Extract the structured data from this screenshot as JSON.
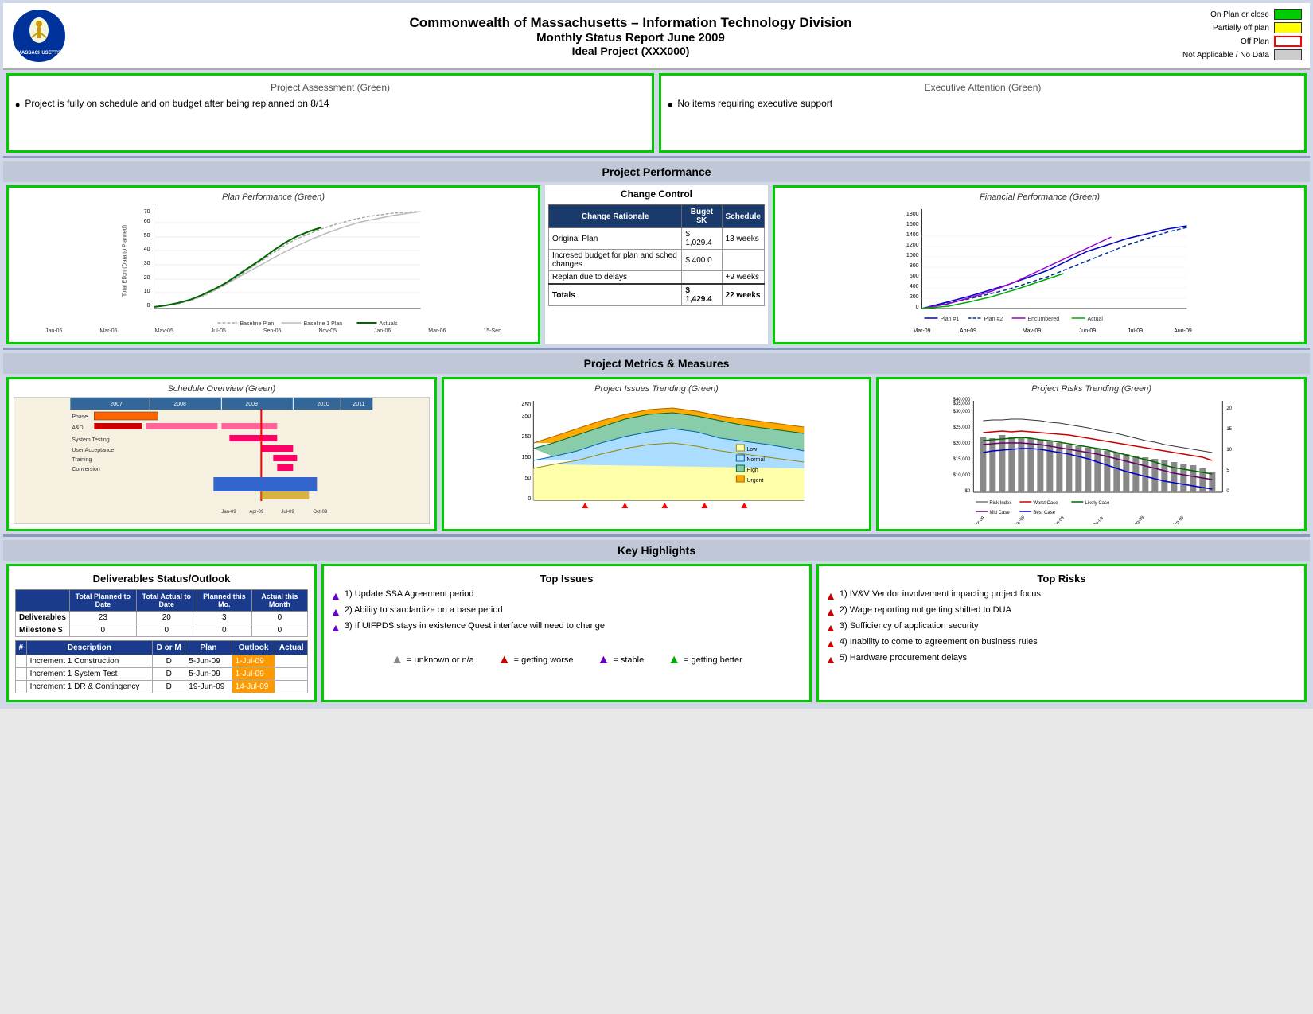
{
  "header": {
    "title_line1": "Commonwealth of Massachusetts – Information Technology Division",
    "title_line2": "Monthly Status Report June 2009",
    "title_line3": "Ideal Project (XXX000)"
  },
  "legend": {
    "items": [
      {
        "label": "On Plan or close",
        "color": "green"
      },
      {
        "label": "Partially off plan",
        "color": "yellow"
      },
      {
        "label": "Off Plan",
        "color": "red"
      },
      {
        "label": "Not Applicable / No Data",
        "color": "gray"
      }
    ]
  },
  "project_assessment": {
    "title": "Project Assessment (Green)",
    "text": "Project is fully on schedule and on budget after being replanned on 8/14"
  },
  "executive_attention": {
    "title": "Executive Attention (Green)",
    "text": "No items requiring executive support"
  },
  "project_performance_header": "Project Performance",
  "plan_performance": {
    "title": "Plan Performance (Green)"
  },
  "change_control": {
    "title": "Change Control",
    "headers": [
      "Change Rationale",
      "Buget $K",
      "Schedule"
    ],
    "rows": [
      {
        "rationale": "Original Plan",
        "budget": "$ 1,029.4",
        "schedule": "13 weeks"
      },
      {
        "rationale": "Incresed budget for plan and sched changes",
        "budget": "$ 400.0",
        "schedule": ""
      },
      {
        "rationale": "Replan due to delays",
        "budget": "",
        "schedule": "+9 weeks"
      },
      {
        "rationale": "Totals",
        "budget": "$ 1,429.4",
        "schedule": "22 weeks"
      }
    ]
  },
  "financial_performance": {
    "title": "Financial Performance (Green)",
    "legend": [
      "Plan #1",
      "Plan #2",
      "Encumbered",
      "Actual"
    ]
  },
  "project_metrics_header": "Project Metrics & Measures",
  "schedule_overview": {
    "title": "Schedule Overview (Green)"
  },
  "issues_trending": {
    "title": "Project Issues Trending (Green)",
    "legend": [
      "Low",
      "Normal",
      "High",
      "Urgent"
    ]
  },
  "risks_trending": {
    "title": "Project Risks Trending (Green)",
    "legend": [
      "Risk Index",
      "Worst Case",
      "Likely Case",
      "Mid Case",
      "Best Case"
    ]
  },
  "key_highlights_header": "Key Highlights",
  "top_issues": {
    "title": "Top Issues",
    "items": [
      "Update SSA Agreement period",
      "Ability to standardize on a base period",
      "If UIFPDS stays in existence Quest interface will need to change"
    ]
  },
  "deliverables": {
    "title": "Deliverables Status/Outlook",
    "summary_headers": [
      "",
      "Total Planned to Date",
      "Total Actual to Date",
      "Planned this Mo.",
      "Actual this Month"
    ],
    "summary_rows": [
      {
        "label": "Deliverables",
        "planned": "23",
        "actual": "20",
        "planned_mo": "3",
        "actual_mo": "0"
      },
      {
        "label": "Milestone $",
        "planned": "0",
        "actual": "0",
        "planned_mo": "0",
        "actual_mo": "0"
      }
    ],
    "detail_headers": [
      "#",
      "Description",
      "D or M",
      "Plan",
      "Outlook",
      "Actual"
    ],
    "detail_rows": [
      {
        "num": "",
        "desc": "Increment 1 Construction",
        "dom": "D",
        "plan": "5-Jun-09",
        "outlook": "1-Jul-09",
        "actual": ""
      },
      {
        "num": "",
        "desc": "Increment 1 System Test",
        "dom": "D",
        "plan": "5-Jun-09",
        "outlook": "1-Jul-09",
        "actual": ""
      },
      {
        "num": "",
        "desc": "Increment 1 DR & Contingency",
        "dom": "D",
        "plan": "19-Jun-09",
        "outlook": "14-Jul-09",
        "actual": ""
      }
    ]
  },
  "top_risks": {
    "title": "Top Risks",
    "items": [
      "IV&V Vendor involvement impacting project focus",
      "Wage reporting not getting shifted to DUA",
      "Sufficiency of application security",
      "Inability to come to agreement on business rules",
      "Hardware procurement delays"
    ]
  },
  "bottom_legend": {
    "items": [
      {
        "symbol": "▲",
        "color": "gray",
        "label": "= unknown or n/a"
      },
      {
        "symbol": "▲",
        "color": "red",
        "label": "= getting worse"
      },
      {
        "symbol": "▲",
        "color": "purple",
        "label": "= stable"
      },
      {
        "symbol": "▲",
        "color": "green",
        "label": "= getting better"
      }
    ]
  }
}
